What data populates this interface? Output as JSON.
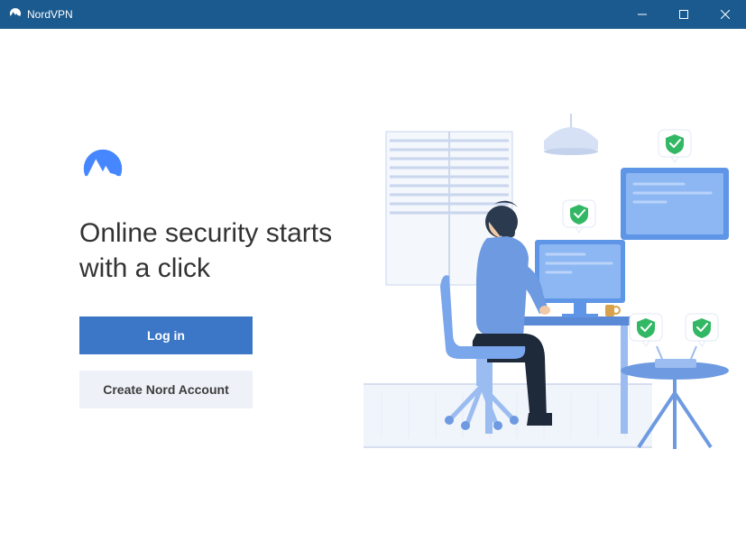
{
  "titlebar": {
    "app_name": "NordVPN"
  },
  "main": {
    "headline": "Online security starts with a click",
    "login_label": "Log in",
    "create_label": "Create Nord Account"
  },
  "colors": {
    "titlebar_bg": "#1b5a8f",
    "primary_btn": "#3b77c6",
    "secondary_btn": "#eef1f7"
  },
  "icons": {
    "app": "nordvpn-logo",
    "minimize": "minimize-icon",
    "maximize": "maximize-icon",
    "close": "close-icon"
  }
}
